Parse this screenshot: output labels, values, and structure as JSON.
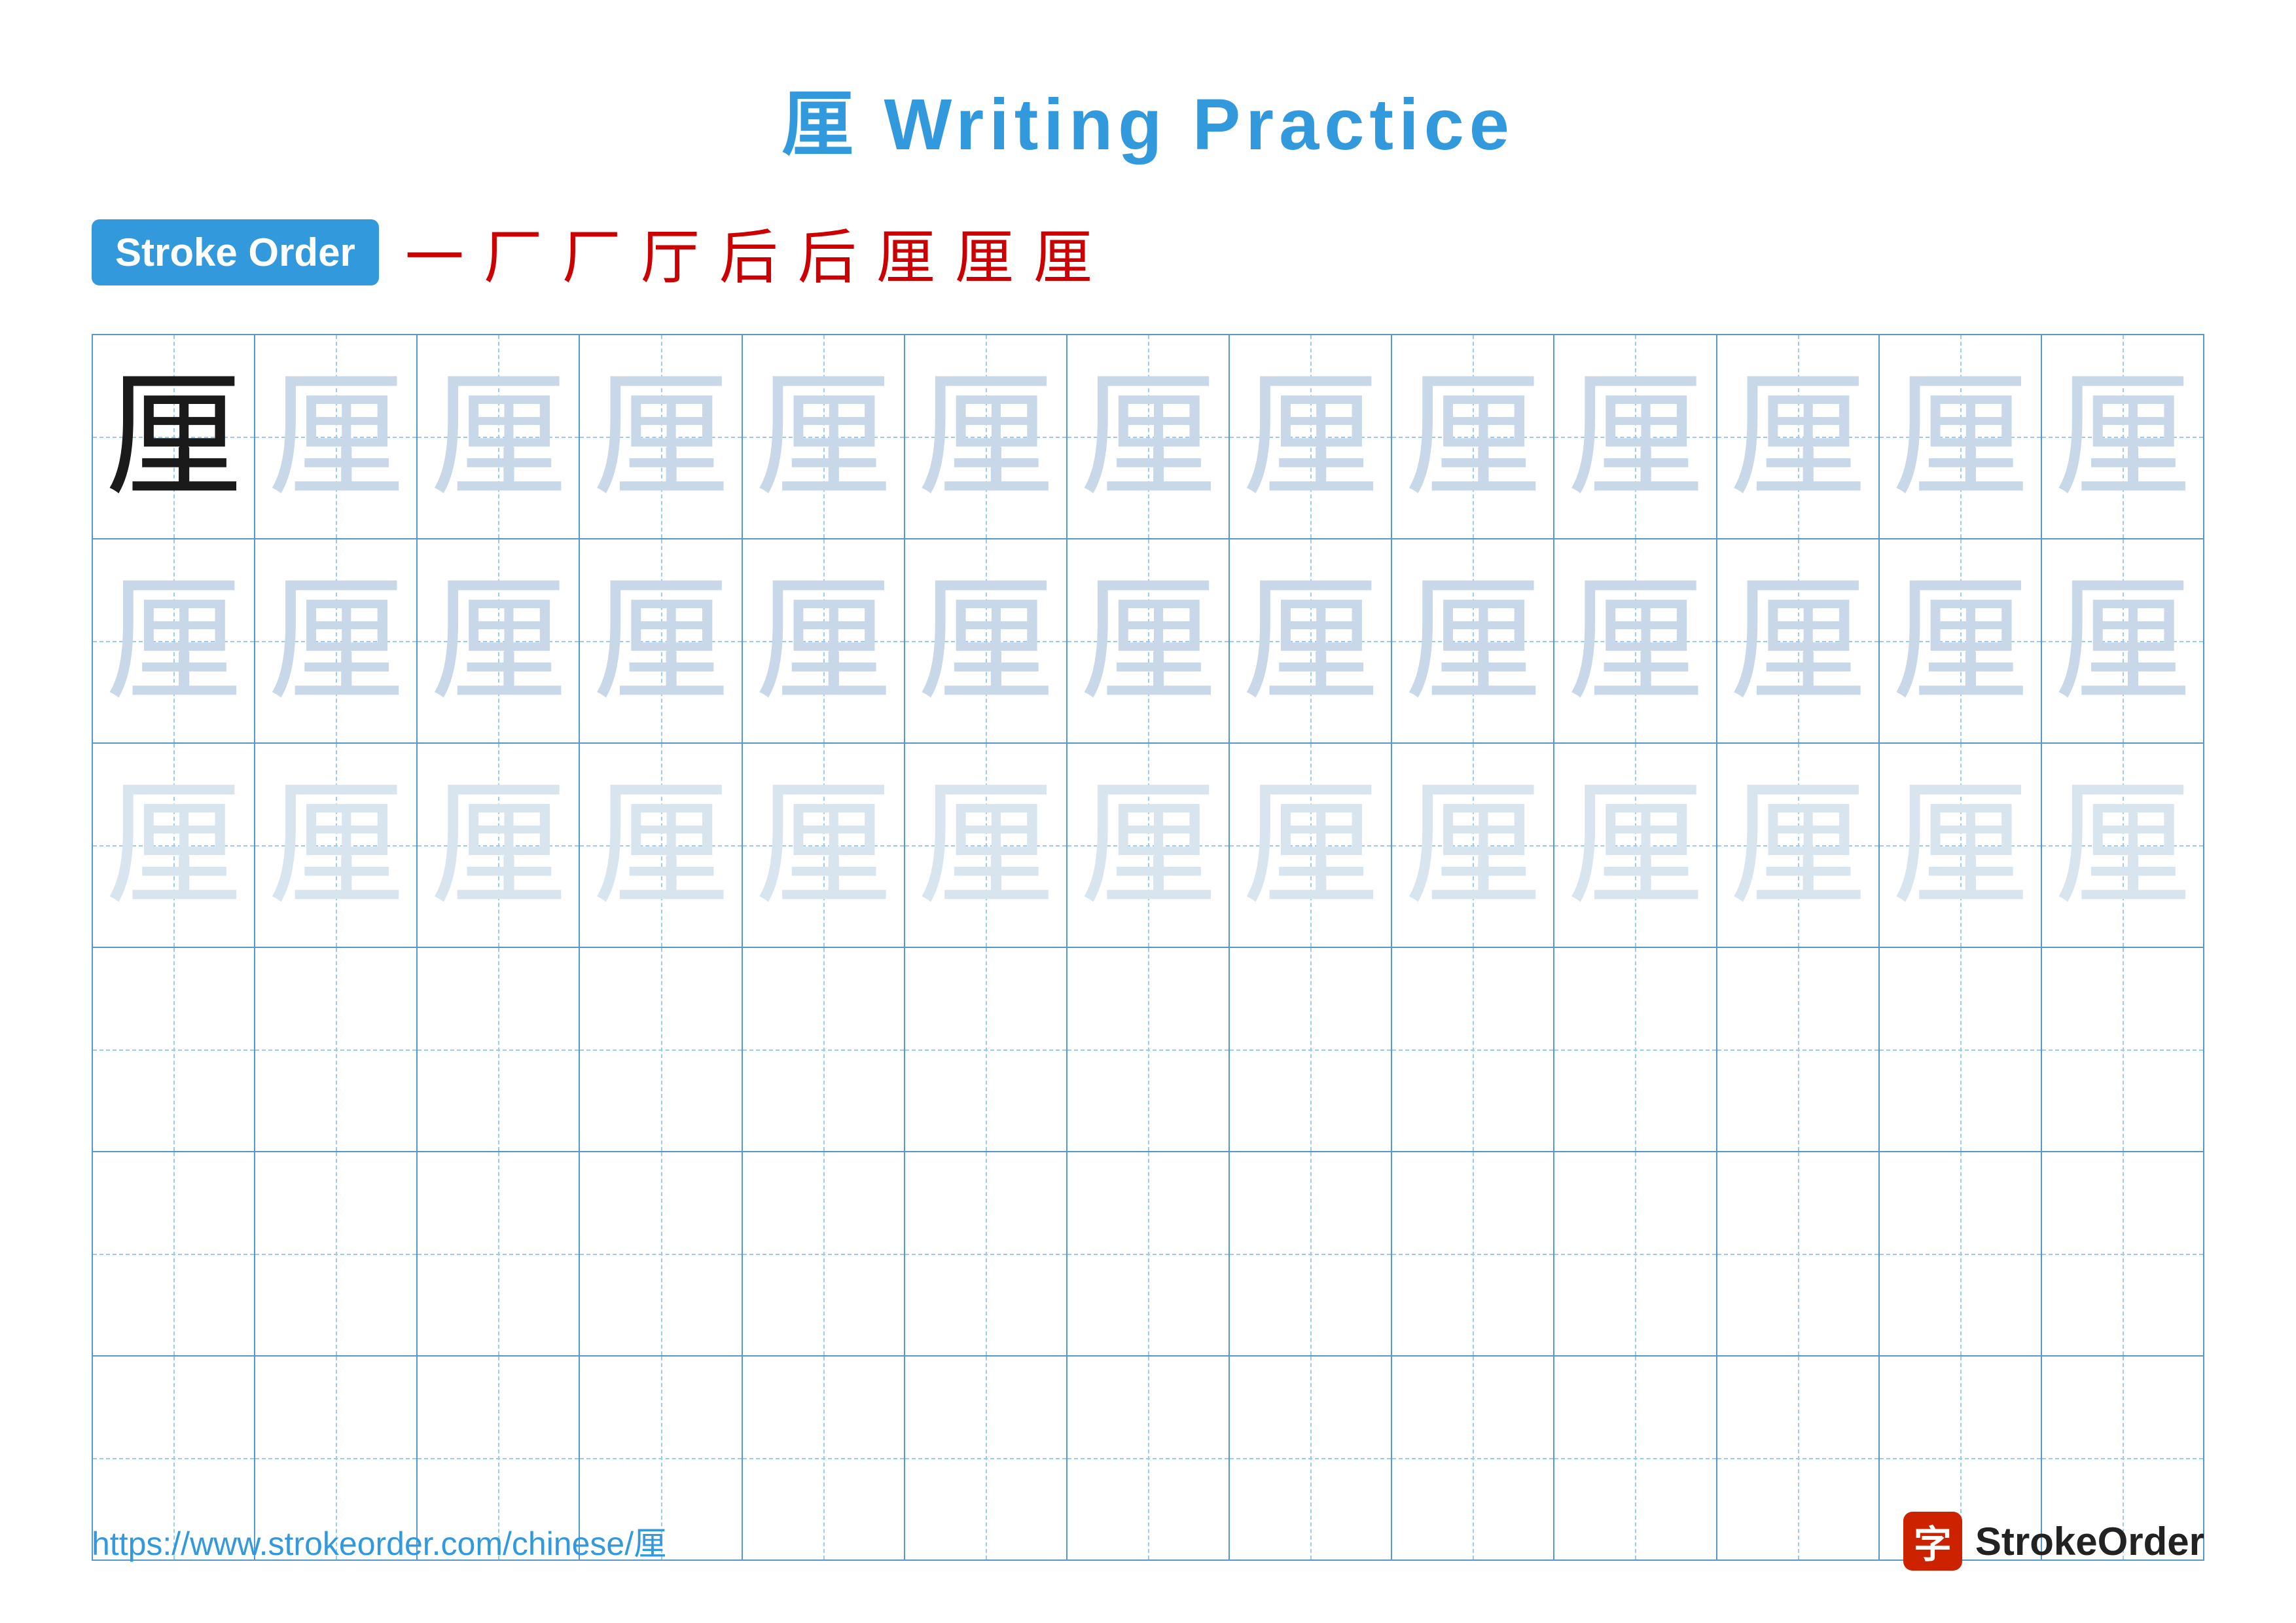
{
  "title": "厘 Writing Practice",
  "stroke_order": {
    "badge_label": "Stroke Order",
    "strokes": [
      "一",
      "厂",
      "厂",
      "厅",
      "后",
      "后",
      "厘",
      "厘",
      "厘"
    ]
  },
  "character": "厘",
  "rows": [
    {
      "type": "solid_then_light1",
      "solid_count": 1,
      "light_count": 12
    },
    {
      "type": "light1",
      "count": 13
    },
    {
      "type": "light2",
      "count": 13
    },
    {
      "type": "empty",
      "count": 13
    },
    {
      "type": "empty",
      "count": 13
    },
    {
      "type": "empty",
      "count": 13
    }
  ],
  "footer": {
    "url": "https://www.strokeorder.com/chinese/厘",
    "logo_char": "字",
    "logo_name": "StrokeOrder"
  },
  "colors": {
    "primary_blue": "#3399dd",
    "grid_blue": "#5599cc",
    "dashed_blue": "#99ccee",
    "red": "#cc0000",
    "solid_char": "#1a1a1a",
    "light1_char": "#c8d8e8",
    "light2_char": "#d8e5ef"
  }
}
